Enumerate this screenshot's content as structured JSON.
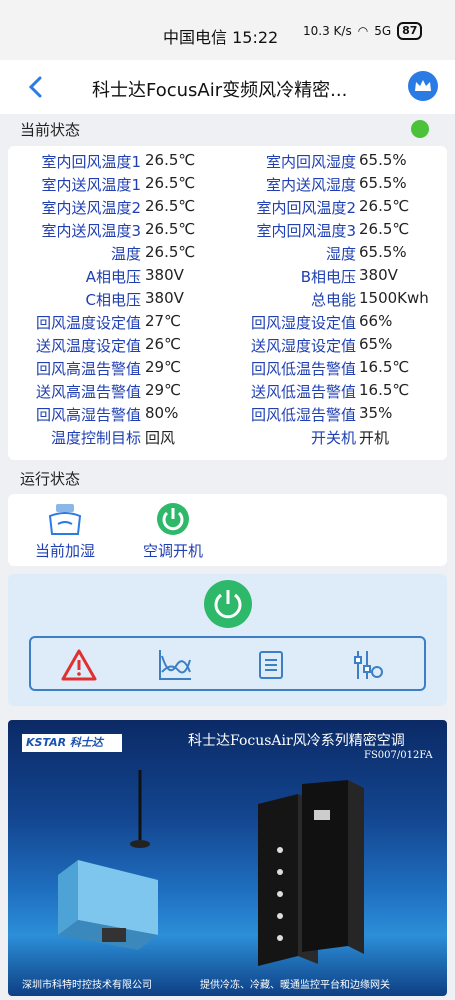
{
  "statusbar": {
    "carrier": "中国电信",
    "time": "15:22",
    "speed": "10.3 K/s",
    "network": "5G",
    "battery": "87"
  },
  "header": {
    "title": "科士达FocusAir变频风冷精密..."
  },
  "current_status": {
    "heading": "当前状态",
    "rows": [
      {
        "l1": "室内回风温度1",
        "v1": "26.5℃",
        "l2": "室内回风湿度",
        "v2": "65.5%"
      },
      {
        "l1": "室内送风温度1",
        "v1": "26.5℃",
        "l2": "室内送风湿度",
        "v2": "65.5%"
      },
      {
        "l1": "室内送风温度2",
        "v1": "26.5℃",
        "l2": "室内回风温度2",
        "v2": "26.5℃"
      },
      {
        "l1": "室内送风温度3",
        "v1": "26.5℃",
        "l2": "室内回风温度3",
        "v2": "26.5℃"
      },
      {
        "l1": "温度",
        "v1": "26.5℃",
        "l2": "湿度",
        "v2": "65.5%"
      },
      {
        "l1": "A相电压",
        "v1": "380V",
        "l2": "B相电压",
        "v2": "380V"
      },
      {
        "l1": "C相电压",
        "v1": "380V",
        "l2": "总电能",
        "v2": "1500Kwh"
      },
      {
        "l1": "回风温度设定值",
        "v1": "27℃",
        "l2": "回风湿度设定值",
        "v2": "66%"
      },
      {
        "l1": "送风温度设定值",
        "v1": "26℃",
        "l2": "送风湿度设定值",
        "v2": "65%"
      },
      {
        "l1": "回风高温告警值",
        "v1": "29℃",
        "l2": "回风低温告警值",
        "v2": "16.5℃"
      },
      {
        "l1": "送风高温告警值",
        "v1": "29℃",
        "l2": "送风低温告警值",
        "v2": "16.5℃"
      },
      {
        "l1": "回风高湿告警值",
        "v1": "80%",
        "l2": "回风低湿告警值",
        "v2": "35%"
      },
      {
        "l1": "温度控制目标",
        "v1": "回风",
        "l2": "开关机",
        "v2": "开机"
      }
    ]
  },
  "run_status": {
    "heading": "运行状态",
    "items": [
      {
        "label": "当前加湿"
      },
      {
        "label": "空调开机"
      }
    ]
  },
  "banner": {
    "brand": "KSTAR 科士达",
    "title": "科士达FocusAir风冷系列精密空调",
    "model": "FS007/012FA",
    "footer_left": "深圳市科特时控技术有限公司",
    "footer_right": "提供冷冻、冷藏、暖通监控平台和边缘网关"
  },
  "colors": {
    "label": "#1f3fb3",
    "accent": "#2b7be4",
    "status_ok": "#4cc23a",
    "power": "#2eb86a",
    "alarm": "#e03030"
  }
}
